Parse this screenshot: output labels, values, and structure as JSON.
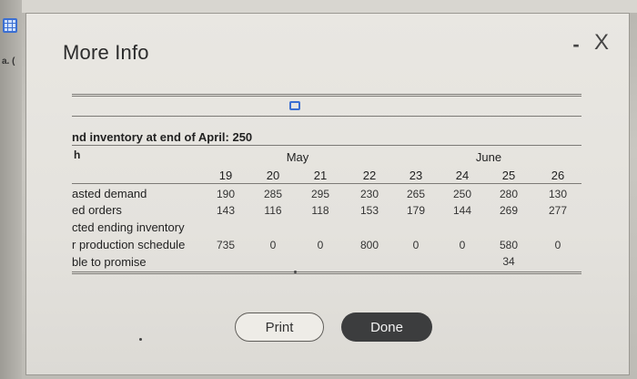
{
  "background": {
    "side_label": "a. (",
    "app_icon": "grid-icon"
  },
  "modal": {
    "title": "More Info",
    "minimize_glyph": "-",
    "close_glyph": "X",
    "copy_icon": "copy-icon"
  },
  "table": {
    "header_text": "nd inventory at end of April: 250",
    "first_col_glyph": "h",
    "months": [
      "May",
      "June"
    ],
    "columns": [
      "19",
      "20",
      "21",
      "22",
      "23",
      "24",
      "25",
      "26"
    ],
    "rows": [
      {
        "label": "asted demand",
        "values": [
          "190",
          "285",
          "295",
          "230",
          "265",
          "250",
          "280",
          "130"
        ]
      },
      {
        "label": "ed orders",
        "values": [
          "143",
          "116",
          "118",
          "153",
          "179",
          "144",
          "269",
          "277"
        ]
      },
      {
        "label": "cted ending inventory",
        "values": [
          "",
          "",
          "",
          "",
          "",
          "",
          "",
          ""
        ]
      },
      {
        "label": "r production schedule",
        "values": [
          "735",
          "0",
          "0",
          "800",
          "0",
          "0",
          "580",
          "0"
        ]
      },
      {
        "label": "ble to promise",
        "values": [
          "",
          "",
          "",
          "",
          "",
          "",
          "34",
          ""
        ]
      }
    ]
  },
  "buttons": {
    "print_label": "Print",
    "done_label": "Done"
  }
}
